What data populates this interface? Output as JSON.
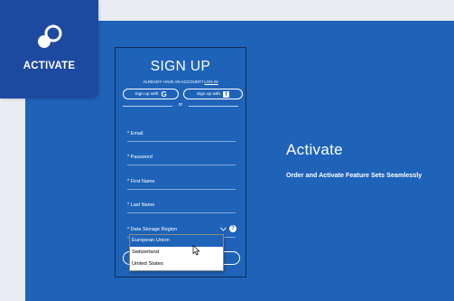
{
  "brand": {
    "label": "ACTIVATE",
    "icon": "link-toggle-icon"
  },
  "signup": {
    "title": "SIGN UP",
    "have_account_text": "ALREADY HAVE AN ACCOUNT?",
    "login_link": "LOG IN",
    "google_label": "Sign up with",
    "google_icon_text": "G",
    "facebook_label": "Sign up with",
    "facebook_icon_text": "f",
    "or_text": "or",
    "fields": {
      "email": "* Email",
      "password": "* Password",
      "first_name": "* First Name",
      "last_name": "* Last Name",
      "region": "* Data Storage Region"
    },
    "help_icon_text": "?"
  },
  "dropdown": {
    "options": [
      "European Union",
      "Switzerland",
      "United States"
    ],
    "selected_index": 0
  },
  "hero": {
    "title": "Activate",
    "subtitle": "Order and Activate Feature Sets Seamlessly"
  },
  "colors": {
    "panel": "#1f63b9",
    "brand_tile": "#1d4aa0",
    "background": "#e9ecf1"
  }
}
